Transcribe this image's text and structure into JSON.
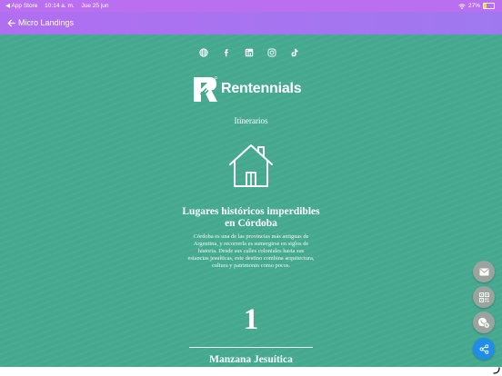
{
  "status_bar": {
    "back_app": "◀ App Store",
    "time": "10:14 a. m.",
    "date": "Jue 25 jun",
    "battery": "27%"
  },
  "app_bar": {
    "back_icon": "arrow-left-icon",
    "title": "Micro Landings"
  },
  "social": [
    "globe-icon",
    "facebook-icon",
    "linkedin-icon",
    "instagram-icon",
    "tiktok-icon"
  ],
  "logo": {
    "text": "Rentennials"
  },
  "section_label": "Itinerarios",
  "card": {
    "icon": "house-icon",
    "title": "Lugares históricos imperdibles en Córdoba",
    "description": "Córdoba es una de las provincias más antiguas de Argentina, y recorrerla es sumergirse en siglos de historia. Desde sus calles coloniales hasta sus estancias jesuíticas, este destino combina arquitectura, cultura y patrimonio como pocos."
  },
  "item": {
    "number": "1",
    "title": "Manzana Jesuítica"
  },
  "fabs": [
    "email-icon",
    "qr-code-icon",
    "whatsapp-icon",
    "share-icon"
  ],
  "colors": {
    "status_bar": "#b96ff0",
    "app_bar_start": "#b06ff0",
    "app_bar_end": "#9f78ef",
    "content_bg": "#45a98f",
    "share_fab": "#1f8ee8",
    "fab": "#9aa49f"
  }
}
